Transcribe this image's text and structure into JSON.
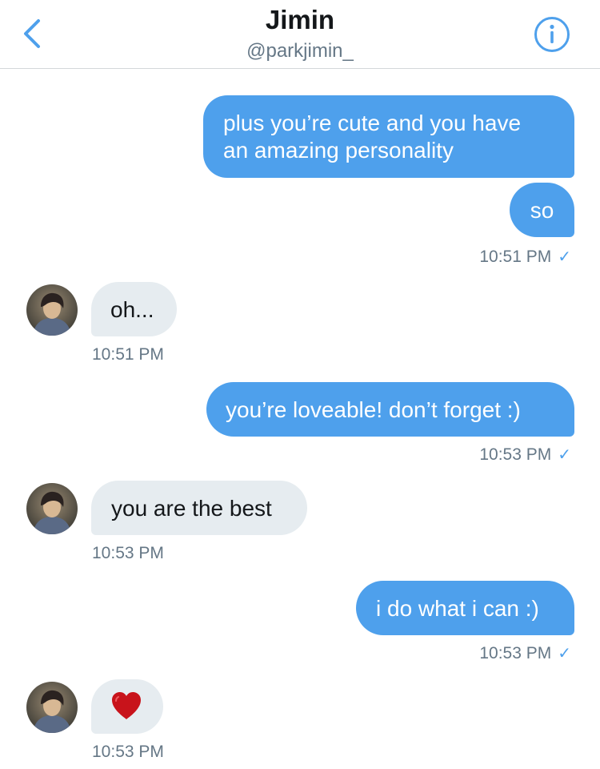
{
  "header": {
    "name": "Jimin",
    "handle": "@parkjimin_",
    "back_icon": "chevron-left-icon",
    "info_icon": "info-icon"
  },
  "colors": {
    "accent": "#4ea0ec",
    "received_bubble": "#e6ecf0",
    "timestamp": "#657786"
  },
  "messages": [
    {
      "direction": "sent",
      "text": "plus you’re cute and you have\nan amazing personality"
    },
    {
      "direction": "sent",
      "text": "so",
      "time": "10:51 PM",
      "read": true
    },
    {
      "direction": "received",
      "text": "oh...",
      "time": "10:51 PM"
    },
    {
      "direction": "sent",
      "text": "you’re loveable! don’t forget :)",
      "time": "10:53 PM",
      "read": true
    },
    {
      "direction": "received",
      "text": "you are the best",
      "time": "10:53 PM"
    },
    {
      "direction": "sent",
      "text": "i do what i can :)",
      "time": "10:53 PM",
      "read": true
    },
    {
      "direction": "received",
      "emoji": "red-heart-icon",
      "time": "10:53 PM"
    }
  ],
  "read_mark": "✓"
}
